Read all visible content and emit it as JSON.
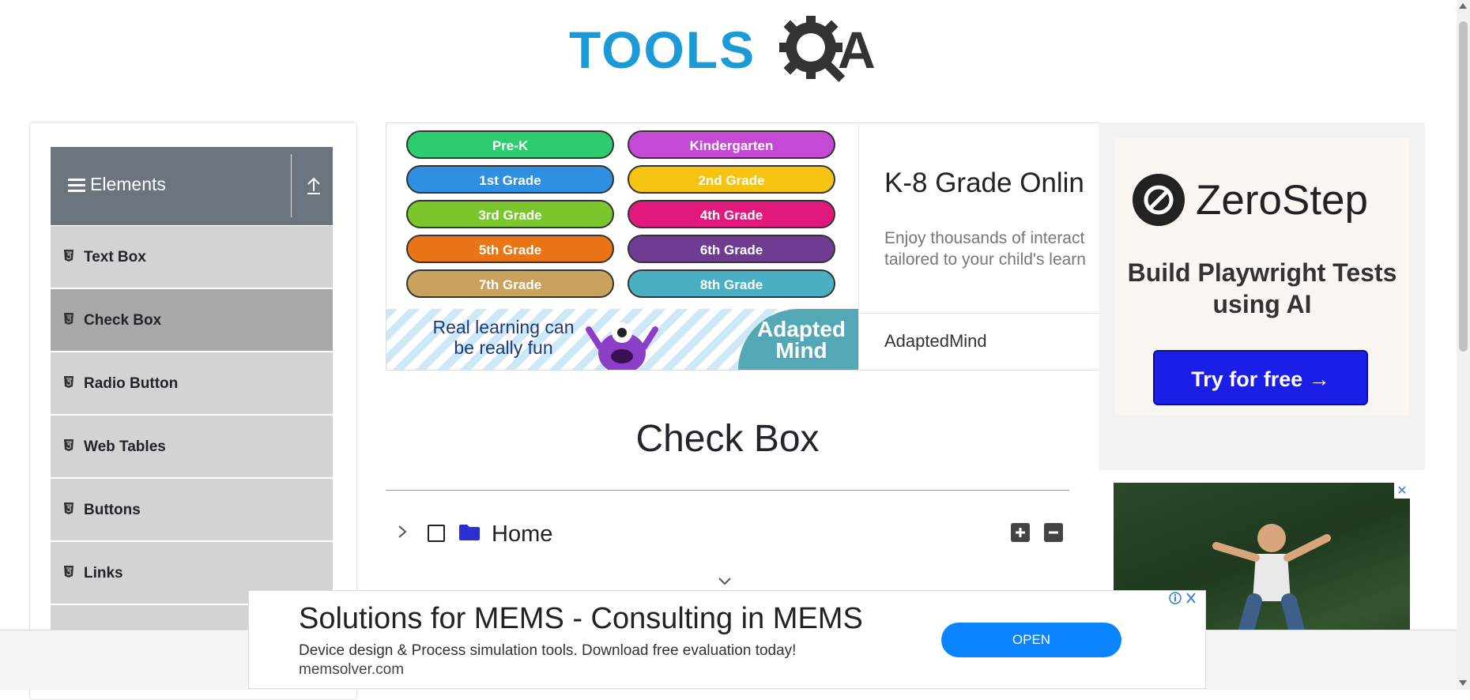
{
  "header": {
    "logo_text_left": "TOOLS",
    "logo_text_right": "A"
  },
  "sidebar": {
    "group_title": "Elements",
    "items": [
      {
        "label": "Text Box",
        "active": false
      },
      {
        "label": "Check Box",
        "active": true
      },
      {
        "label": "Radio Button",
        "active": false
      },
      {
        "label": "Web Tables",
        "active": false
      },
      {
        "label": "Buttons",
        "active": false
      },
      {
        "label": "Links",
        "active": false
      }
    ]
  },
  "top_ad": {
    "grades": [
      {
        "label": "Pre-K",
        "color": "#2ecc71"
      },
      {
        "label": "Kindergarten",
        "color": "#c44ad6"
      },
      {
        "label": "1st Grade",
        "color": "#2f8fe0"
      },
      {
        "label": "2nd Grade",
        "color": "#f5c310"
      },
      {
        "label": "3rd Grade",
        "color": "#7bc62d"
      },
      {
        "label": "4th Grade",
        "color": "#e2197c"
      },
      {
        "label": "5th Grade",
        "color": "#e97516"
      },
      {
        "label": "6th Grade",
        "color": "#6e3d91"
      },
      {
        "label": "7th Grade",
        "color": "#c9a35e"
      },
      {
        "label": "8th Grade",
        "color": "#4aafc0"
      }
    ],
    "slogan": "Real learning can be really fun",
    "brand": "Adapted Mind",
    "headline": "K-8 Grade Onlin",
    "body_line1": "Enjoy thousands of interact",
    "body_line2": "tailored to your child's learn",
    "source": "AdaptedMind"
  },
  "main": {
    "title": "Check Box",
    "tree": {
      "root_label": "Home"
    }
  },
  "right_ad": {
    "brand": "ZeroStep",
    "tagline": "Build Playwright Tests using AI",
    "cta": "Try for free →",
    "close": "✕"
  },
  "bottom_ad": {
    "headline": "Solutions for MEMS - Consulting in MEMS",
    "description": "Device design & Process simulation tools. Download free evaluation today!",
    "url": "memsolver.com",
    "cta": "OPEN"
  },
  "colors": {
    "accent": "#1a9ad6",
    "sidebar_header": "#6c757d",
    "sidebar_item": "#d3d3d3",
    "sidebar_active": "#a9a9a9",
    "cta_blue": "#0a84ff"
  }
}
